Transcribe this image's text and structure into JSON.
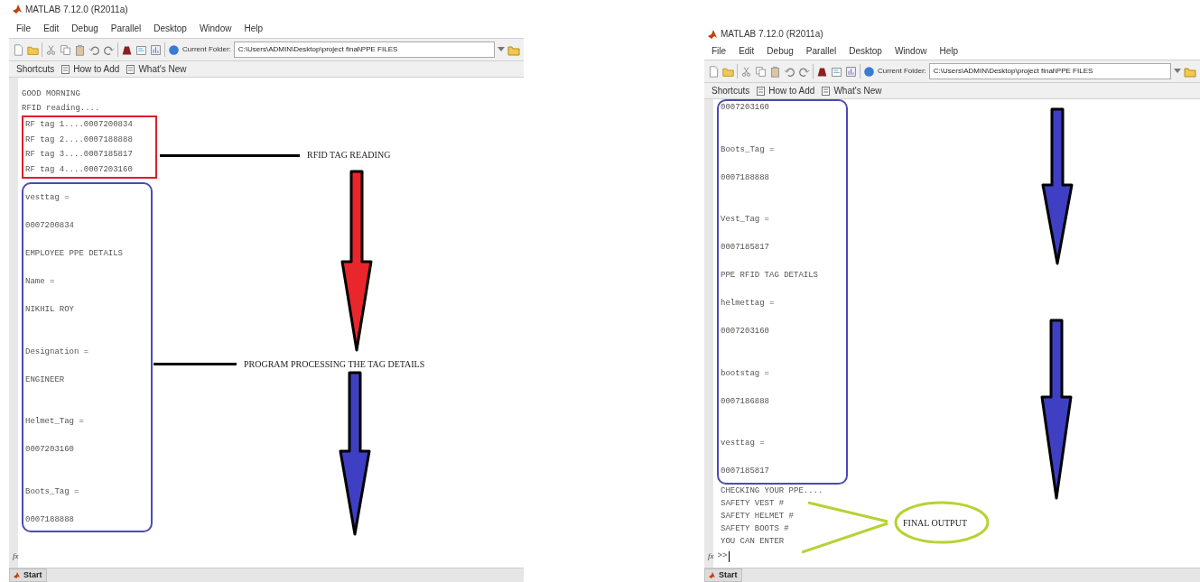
{
  "windows": [
    {
      "title": "MATLAB 7.12.0 (R2011a)",
      "menu": [
        "File",
        "Edit",
        "Debug",
        "Parallel",
        "Desktop",
        "Window",
        "Help"
      ],
      "current_folder_label": "Current Folder:",
      "current_folder": "C:\\Users\\ADMIN\\Desktop\\project final\\PPE FILES",
      "shortcuts": [
        "Shortcuts",
        "How to Add",
        "What's New"
      ],
      "console": {
        "lines_before": [
          {
            "kind": "text",
            "text": "GOOD MORNING"
          },
          {
            "kind": "text",
            "text": "RFID reading...."
          }
        ],
        "red_box": [
          {
            "kind": "text",
            "text": "RF tag 1....0007200834"
          },
          {
            "kind": "text",
            "text": "RF tag 2....0007188888"
          },
          {
            "kind": "text",
            "text": "RF tag 3....0007185817"
          },
          {
            "kind": "text",
            "text": "RF tag 4....0007203160"
          }
        ],
        "blue_box": [
          {
            "kind": "text",
            "text": "vesttag ="
          },
          {
            "kind": "spacer"
          },
          {
            "kind": "text",
            "text": "0007200834"
          },
          {
            "kind": "spacer"
          },
          {
            "kind": "text",
            "text": "EMPLOYEE PPE DETAILS"
          },
          {
            "kind": "spacer"
          },
          {
            "kind": "text",
            "text": "Name ="
          },
          {
            "kind": "spacer"
          },
          {
            "kind": "text",
            "text": "NIKHIL ROY"
          },
          {
            "kind": "spacer"
          },
          {
            "kind": "spacer"
          },
          {
            "kind": "text",
            "text": "Designation ="
          },
          {
            "kind": "spacer"
          },
          {
            "kind": "text",
            "text": "ENGINEER"
          },
          {
            "kind": "spacer"
          },
          {
            "kind": "spacer"
          },
          {
            "kind": "text",
            "text": "Helmet_Tag ="
          },
          {
            "kind": "spacer"
          },
          {
            "kind": "text",
            "text": "0007203160"
          },
          {
            "kind": "spacer"
          },
          {
            "kind": "spacer"
          },
          {
            "kind": "text",
            "text": "Boots_Tag ="
          },
          {
            "kind": "spacer"
          },
          {
            "kind": "text",
            "text": "0007188888"
          }
        ],
        "prompt": "fx"
      },
      "start": "Start",
      "annotations": [
        {
          "kind": "label",
          "text": "RFID TAG READING"
        },
        {
          "kind": "arrow",
          "color": "#e8262b"
        },
        {
          "kind": "label",
          "text": "PROGRAM PROCESSING THE TAG DETAILS"
        },
        {
          "kind": "arrow",
          "color": "#3f3fc4"
        }
      ]
    },
    {
      "title": "MATLAB 7.12.0 (R2011a)",
      "menu": [
        "File",
        "Edit",
        "Debug",
        "Parallel",
        "Desktop",
        "Window",
        "Help"
      ],
      "current_folder_label": "Current Folder:",
      "current_folder": "C:\\Users\\ADMIN\\Desktop\\project final\\PPE FILES",
      "shortcuts": [
        "Shortcuts",
        "How to Add",
        "What's New"
      ],
      "console": {
        "blue_box": [
          {
            "kind": "text",
            "text": "0007203160"
          },
          {
            "kind": "spacer"
          },
          {
            "kind": "spacer"
          },
          {
            "kind": "text",
            "text": "Boots_Tag ="
          },
          {
            "kind": "spacer"
          },
          {
            "kind": "text",
            "text": "0007188888"
          },
          {
            "kind": "spacer"
          },
          {
            "kind": "spacer"
          },
          {
            "kind": "text",
            "text": "Vest_Tag ="
          },
          {
            "kind": "spacer"
          },
          {
            "kind": "text",
            "text": "0007185817"
          },
          {
            "kind": "spacer"
          },
          {
            "kind": "text",
            "text": "PPE RFID TAG DETAILS"
          },
          {
            "kind": "spacer"
          },
          {
            "kind": "text",
            "text": "helmettag ="
          },
          {
            "kind": "spacer"
          },
          {
            "kind": "text",
            "text": "0007203160"
          },
          {
            "kind": "spacer"
          },
          {
            "kind": "spacer"
          },
          {
            "kind": "text",
            "text": "bootstag ="
          },
          {
            "kind": "spacer"
          },
          {
            "kind": "text",
            "text": "0007186888"
          },
          {
            "kind": "spacer"
          },
          {
            "kind": "spacer"
          },
          {
            "kind": "text",
            "text": "vesttag ="
          },
          {
            "kind": "spacer"
          },
          {
            "kind": "text",
            "text": "0007185817"
          }
        ],
        "lines_after": [
          {
            "kind": "text",
            "text": "CHECKING YOUR PPE...."
          },
          {
            "kind": "text",
            "text": "SAFETY VEST #"
          },
          {
            "kind": "text",
            "text": "SAFETY HELMET #"
          },
          {
            "kind": "text",
            "text": "SAFETY BOOTS #"
          },
          {
            "kind": "text",
            "text": "YOU CAN ENTER"
          }
        ],
        "prompt": "fx",
        "command": ">>"
      },
      "start": "Start",
      "annotations": [
        {
          "kind": "arrow",
          "color": "#3f3fc4"
        },
        {
          "kind": "arrow",
          "color": "#3f3fc4"
        },
        {
          "kind": "callout",
          "text": "FINAL OUTPUT"
        }
      ]
    }
  ]
}
